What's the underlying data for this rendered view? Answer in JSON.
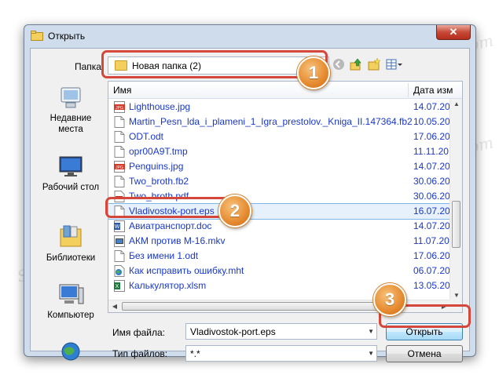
{
  "window": {
    "title": "Открыть",
    "close_glyph": "✕"
  },
  "toolbar": {
    "folder_label": "Папка:",
    "folder_value": "Новая папка (2)"
  },
  "places": [
    {
      "label_line1": "Недавние",
      "label_line2": "места"
    },
    {
      "label_line1": "Рабочий стол",
      "label_line2": ""
    },
    {
      "label_line1": "Библиотеки",
      "label_line2": ""
    },
    {
      "label_line1": "Компьютер",
      "label_line2": ""
    }
  ],
  "columns": {
    "name": "Имя",
    "date": "Дата изм"
  },
  "files": [
    {
      "name": "Lighthouse.jpg",
      "date": "14.07.20",
      "icon": "jpg-icon"
    },
    {
      "name": "Martin_Pesn_lda_i_plameni_1_Igra_prestolov._Kniga_II.147364.fb2",
      "date": "10.05.20",
      "icon": "file-icon"
    },
    {
      "name": "ODT.odt",
      "date": "17.06.20",
      "icon": "file-icon"
    },
    {
      "name": "opr00A9T.tmp",
      "date": "11.11.20",
      "icon": "file-icon"
    },
    {
      "name": "Penguins.jpg",
      "date": "14.07.20",
      "icon": "jpg-icon"
    },
    {
      "name": "Two_broth.fb2",
      "date": "30.06.20",
      "icon": "file-icon"
    },
    {
      "name": "Two_broth.pdf",
      "date": "30.06.20",
      "icon": "pdf-icon"
    },
    {
      "name": "Vladivostok-port.eps",
      "date": "16.07.20",
      "icon": "file-icon",
      "selected": true
    },
    {
      "name": "Авиатранспорт.doc",
      "date": "14.07.20",
      "icon": "word-icon"
    },
    {
      "name": "АКМ против М-16.mkv",
      "date": "11.07.20",
      "icon": "video-icon"
    },
    {
      "name": "Без имени 1.odt",
      "date": "17.06.20",
      "icon": "file-icon"
    },
    {
      "name": "Как исправить ошибку.mht",
      "date": "06.07.20",
      "icon": "globe-icon"
    },
    {
      "name": "Калькулятор.xlsm",
      "date": "13.05.20",
      "icon": "excel-icon"
    }
  ],
  "form": {
    "filename_label": "Имя файла:",
    "filename_value": "Vladivostok-port.eps",
    "filetype_label": "Тип файлов:",
    "filetype_value": "*.*",
    "open_button": "Открыть",
    "cancel_button": "Отмена"
  },
  "badges": [
    "1",
    "2",
    "3"
  ],
  "watermark": "Soringpcrepair.com",
  "colors": {
    "highlight": "#d5473b",
    "badge": "#e58a30",
    "link_text": "#1a38c8"
  }
}
